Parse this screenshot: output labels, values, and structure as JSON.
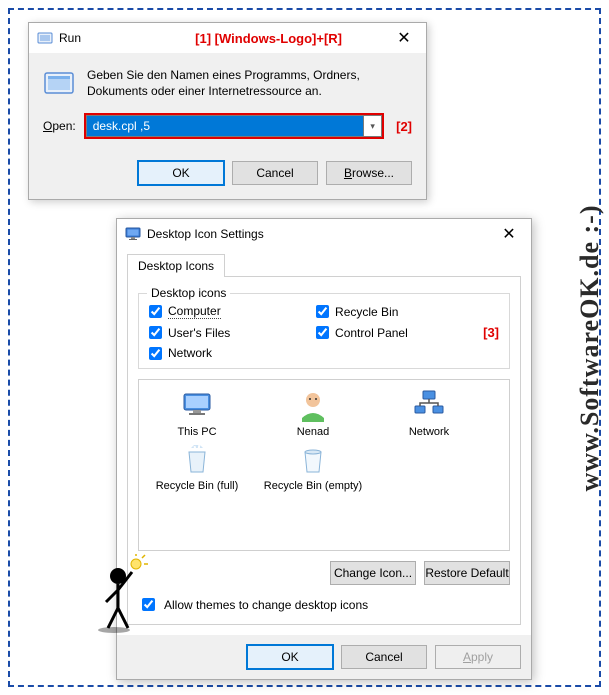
{
  "run": {
    "title": "Run",
    "annotation": "[1]  [Windows-Logo]+[R]",
    "description": "Geben Sie den Namen eines Programms, Ordners, Dokuments oder einer Internetressource an.",
    "open_label": "Open:",
    "input_value": "desk.cpl ,5",
    "input_annotation": "[2]",
    "buttons": {
      "ok": "OK",
      "cancel": "Cancel",
      "browse": "Browse..."
    }
  },
  "dis": {
    "title": "Desktop Icon Settings",
    "tab": "Desktop Icons",
    "group_title": "Desktop icons",
    "checks": {
      "computer": "Computer",
      "users_files": "User's Files",
      "network": "Network",
      "recycle_bin": "Recycle Bin",
      "control_panel": "Control Panel"
    },
    "annotation": "[3]",
    "preview": {
      "this_pc": "This PC",
      "user": "Nenad",
      "network": "Network",
      "rb_full": "Recycle Bin (full)",
      "rb_empty": "Recycle Bin (empty)"
    },
    "change_icon": "Change Icon...",
    "restore_default": "Restore Default",
    "allow_themes": "Allow themes to change desktop icons",
    "footer": {
      "ok": "OK",
      "cancel": "Cancel",
      "apply": "Apply"
    }
  },
  "watermark": "www.SoftwareOK.de :-)"
}
